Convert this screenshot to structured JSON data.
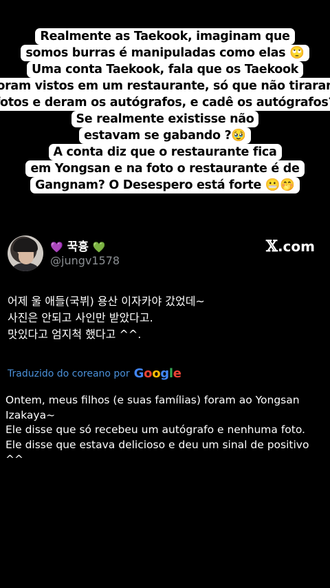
{
  "overlay": {
    "lines": [
      "Realmente as Taekook, imaginam que",
      "somos burras é manipuladas como elas 🙄",
      "Uma conta Taekook, fala que os Taekook",
      "foram vistos em um restaurante, só que não tiraram",
      "fotos e deram os autógrafos, e cadê os autógrafos?",
      "Se realmente existisse não",
      "estavam se gabando ?🥹",
      "A conta diz que o restaurante fica",
      "em Yongsan e na foto o restaurante é de",
      "Gangnam? O Desespero está forte 😬🤭"
    ]
  },
  "tweet": {
    "display_name": "꾹흉",
    "handle": "@jungv1578",
    "brand_x": "𝕏",
    "brand_suffix": ".com",
    "original_lines": [
      "어제 울 애들(국뷔) 용산 이자카야 갔었데~",
      "사진은 안되고 사인만 받았다고.",
      "맛있다고 엄지척 했다고 ^^."
    ],
    "translated_by": "Traduzido do coreano por",
    "translation_lines": [
      "Ontem, meus filhos (e suas famílias) foram ao Yongsan",
      "Izakaya~",
      "Ele disse que só recebeu um autógrafo e nenhuma foto.",
      "Ele disse que estava delicioso e deu um sinal de positivo",
      "^^"
    ]
  },
  "icons": {
    "heart_left": "purple-heart-icon",
    "heart_right": "green-heart-icon",
    "google_logo": "google-logo"
  },
  "colors": {
    "background": "#000000",
    "overlay_bg": "#ffffff",
    "handle": "#8b8f93",
    "link": "#4a90d9"
  }
}
